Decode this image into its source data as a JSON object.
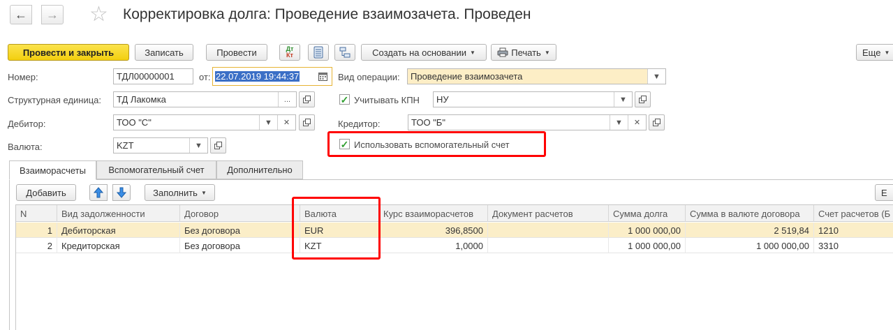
{
  "window": {
    "title": "Корректировка долга: Проведение взаимозачета. Проведен",
    "back_icon": "←",
    "forward_icon": "→",
    "star_icon": "☆"
  },
  "toolbar": {
    "post_close": "Провести и закрыть",
    "save": "Записать",
    "post": "Провести",
    "dt_kt_top": "Дт",
    "dt_kt_bottom": "Кт",
    "create_based": "Создать на основании",
    "print": "Печать",
    "more": "Еще"
  },
  "form": {
    "number_label": "Номер:",
    "number_value": "ТДЛ00000001",
    "date_label": "от:",
    "date_value": "22.07.2019 19:44:37",
    "operation_label": "Вид операции:",
    "operation_value": "Проведение взаимозачета",
    "unit_label": "Структурная единица:",
    "unit_value": "ТД Лакомка",
    "kpn_label": "Учитывать КПН",
    "kpn_value": "НУ",
    "debtor_label": "Дебитор:",
    "debtor_value": "ТОО \"С\"",
    "creditor_label": "Кредитор:",
    "creditor_value": "ТОО \"Б\"",
    "currency_label": "Валюта:",
    "currency_value": "KZT",
    "aux_account_label": "Использовать вспомогательный счет",
    "kpn_checked": true,
    "aux_checked": true
  },
  "tabs": [
    {
      "label": "Взаиморасчеты"
    },
    {
      "label": "Вспомогательный счет"
    },
    {
      "label": "Дополнительно"
    }
  ],
  "table_toolbar": {
    "add": "Добавить",
    "fill": "Заполнить",
    "more_partial": "Е"
  },
  "table": {
    "columns": [
      "N",
      "Вид задолженности",
      "Договор",
      "Валюта",
      "Курс взаиморасчетов",
      "Документ расчетов",
      "Сумма долга",
      "Сумма в валюте договора",
      "Счет расчетов (Б"
    ],
    "rows": [
      {
        "n": "1",
        "kind": "Дебиторская",
        "contract": "Без договора",
        "currency": "EUR",
        "rate": "396,8500",
        "doc": "",
        "amount": "1 000 000,00",
        "amount_contract": "2 519,84",
        "account": "1210"
      },
      {
        "n": "2",
        "kind": "Кредиторская",
        "contract": "Без договора",
        "currency": "KZT",
        "rate": "1,0000",
        "doc": "",
        "amount": "1 000 000,00",
        "amount_contract": "1 000 000,00",
        "account": "3310"
      }
    ]
  },
  "colors": {
    "primary_button": "#f3cf0f",
    "highlight_frame": "#ff0000",
    "selected_row": "#fbeec8",
    "date_selection": "#3b6fc6"
  }
}
